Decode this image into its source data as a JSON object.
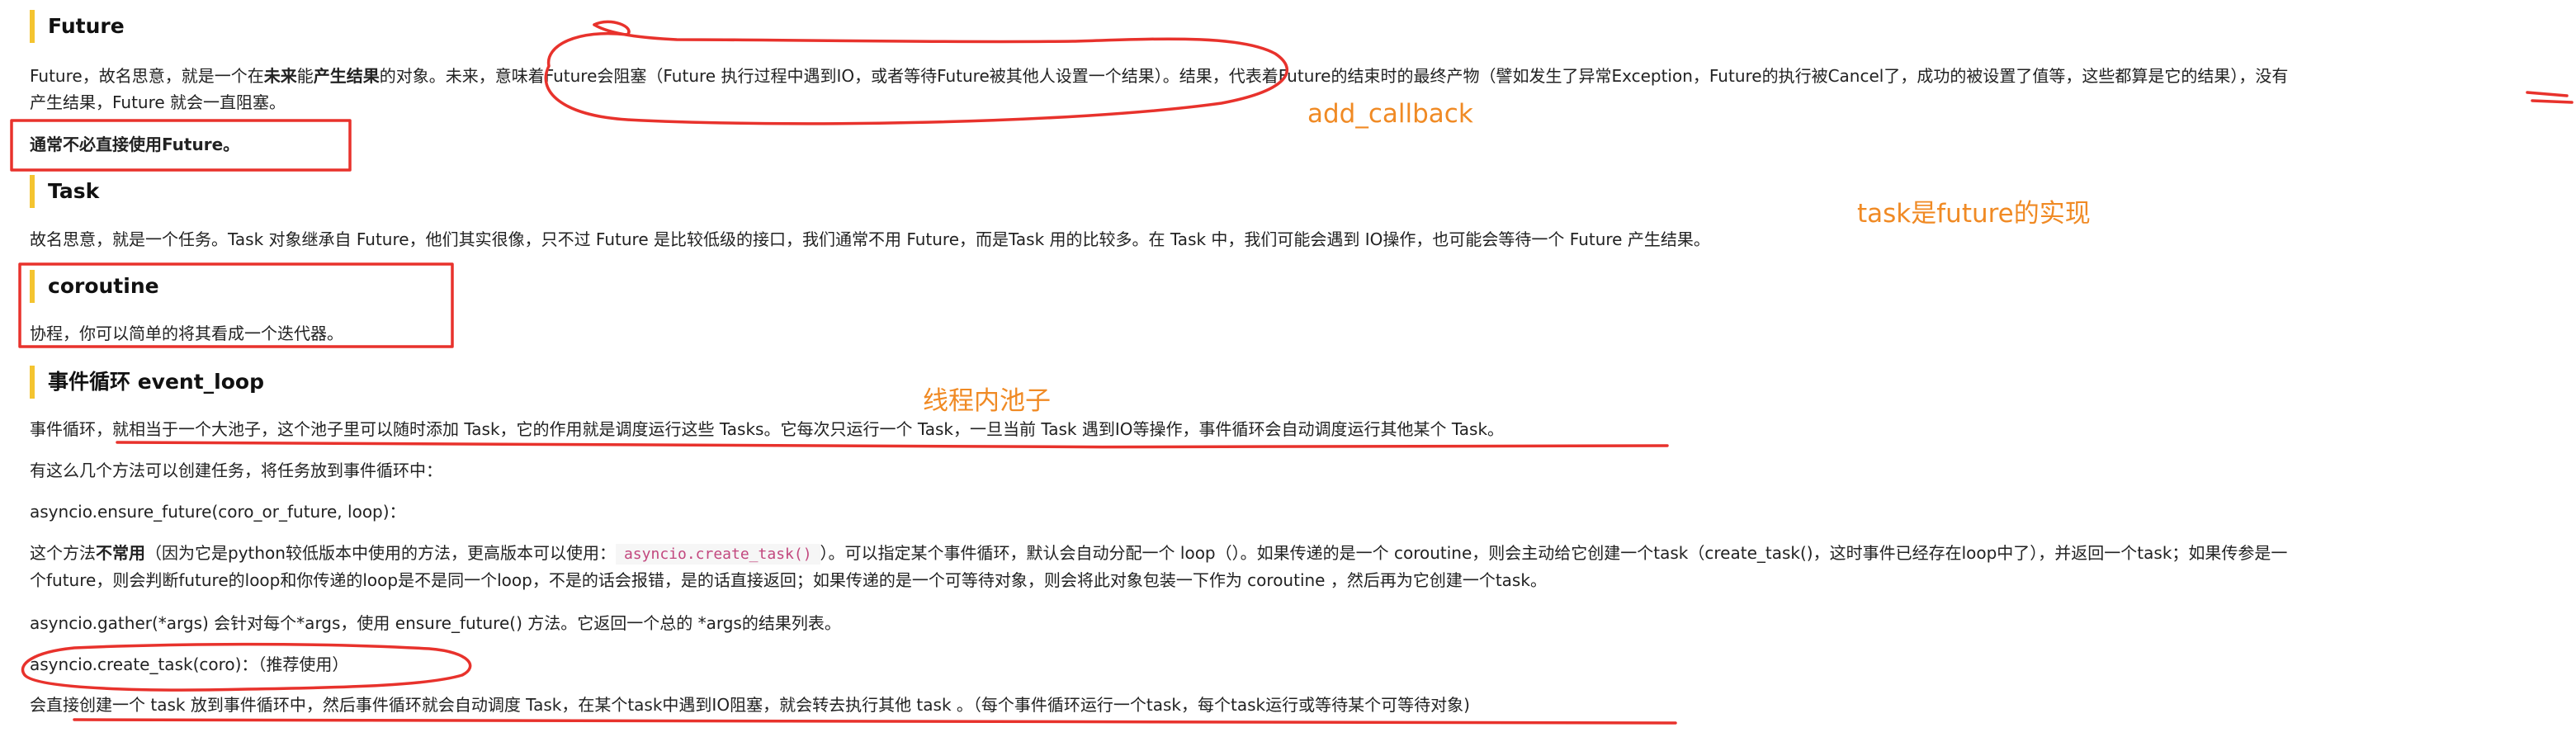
{
  "colors": {
    "heading_bar": "#f4c430",
    "annotation": "#f08a24",
    "ink": "#e8322c",
    "code": "#c2477e"
  },
  "future": {
    "heading": "Future",
    "para_line1": "Future，故名思意，就是一个在",
    "para_bold1": "未来",
    "para_mid1": "能",
    "para_bold2": "产生结果",
    "para_rest": "的对象。未来，意味着Future会阻塞（Future 执行过程中遇到IO，或者等待Future被其他人设置一个结果）。结果，代表着Future的结束时的最终产物（譬如发生了异常Exception，Future的执行被Cancel了，成功的被设置了值等，这些都算是它的结果），没有",
    "para_line2": "产生结果，Future 就会一直阻塞。",
    "tip": "通常不必直接使用Future。"
  },
  "task": {
    "heading": "Task",
    "para": "故名思意，就是一个任务。Task 对象继承自 Future，他们其实很像，只不过 Future 是比较低级的接口，我们通常不用 Future，而是Task 用的比较多。在 Task 中，我们可能会遇到 IO操作，也可能会等待一个 Future 产生结果。"
  },
  "coroutine": {
    "heading": "coroutine",
    "para": "协程，你可以简单的将其看成一个迭代器。"
  },
  "event_loop": {
    "heading": "事件循环 event_loop",
    "para": "事件循环，就相当于一个大池子，这个池子里可以随时添加 Task，它的作用就是调度运行这些 Tasks。它每次只运行一个 Task，一旦当前 Task 遇到IO等操作，事件循环会自动调度运行其他某个 Task。",
    "intro": "有这么几个方法可以创建任务，将任务放到事件循环中：",
    "ensure_future_sig": "asyncio.ensure_future(coro_or_future, loop)：",
    "ef_pre": "这个方法",
    "ef_bold": "不常用",
    "ef_mid": "（因为它是python较低版本中使用的方法，更高版本可以使用：",
    "ef_code": "asyncio.create_task()",
    "ef_rest": "）。可以指定某个事件循环，默认会自动分配一个 loop（）。如果传递的是一个 coroutine，则会主动给它创建一个task（create_task()，这时事件已经存在loop中了），并返回一个task；如果传参是一",
    "ef_line2": "个future，则会判断future的loop和你传递的loop是不是同一个loop，不是的话会报错，是的话直接返回；如果传递的是一个可等待对象，则会将此对象包装一下作为 coroutine ，然后再为它创建一个task。",
    "gather": "asyncio.gather(*args) 会针对每个*args，使用 ensure_future() 方法。它返回一个总的 *args的结果列表。",
    "create_task_sig": "asyncio.create_task(coro)：（推荐使用）",
    "create_task_desc": "会直接创建一个 task 放到事件循环中，然后事件循环就会自动调度 Task，在某个task中遇到IO阻塞，就会转去执行其他 task 。（每个事件循环运行一个task，每个task运行或等待某个可等待对象)"
  },
  "annotations": {
    "add_callback": "add_callback",
    "task_is_future": "task是future的实现",
    "thread_pool": "线程内池子"
  }
}
